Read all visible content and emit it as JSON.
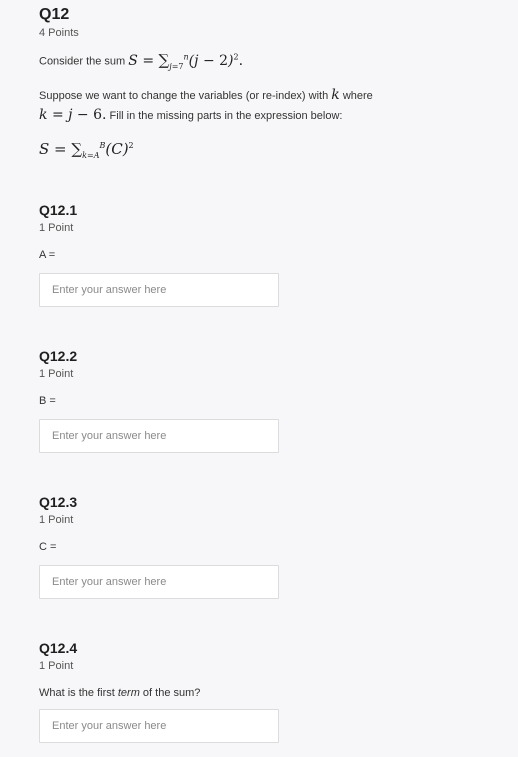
{
  "question": {
    "title": "Q12",
    "points": "4 Points",
    "line1_prefix": "Consider the sum",
    "line2_part1": "Suppose we want to change the variables (or re-index) with",
    "line2_part2": "where",
    "line3_part2": "Fill in the missing parts in the expression below:"
  },
  "subquestions": [
    {
      "title": "Q12.1",
      "points": "1 Point",
      "label": "A =",
      "placeholder": "Enter your answer here"
    },
    {
      "title": "Q12.2",
      "points": "1 Point",
      "label": "B =",
      "placeholder": "Enter your answer here"
    },
    {
      "title": "Q12.3",
      "points": "1 Point",
      "label": "C =",
      "placeholder": "Enter your answer here"
    },
    {
      "title": "Q12.4",
      "points": "1 Point",
      "label_before": "What is the first",
      "label_em": "term",
      "label_after": "of the sum?",
      "placeholder": "Enter your answer here"
    }
  ]
}
